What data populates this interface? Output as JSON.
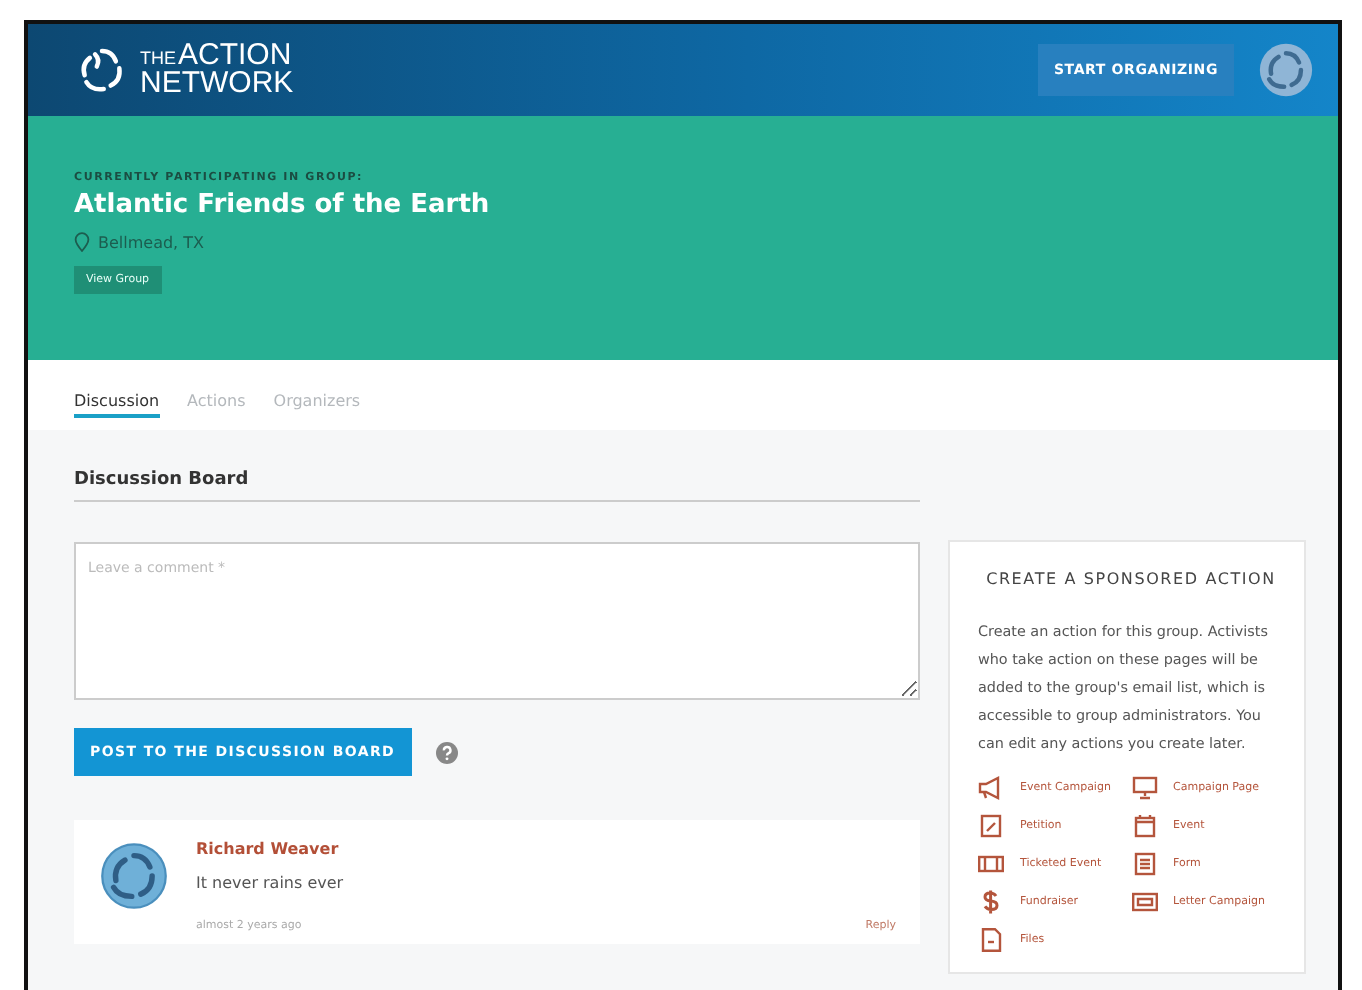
{
  "header": {
    "logo": {
      "small": "THE",
      "line1": "ACTION",
      "line2": "NETWORK"
    },
    "button": "START ORGANIZING"
  },
  "group": {
    "eyebrow": "CURRENTLY PARTICIPATING IN GROUP:",
    "name": "Atlantic Friends of the Earth",
    "location": "Bellmead, TX",
    "button": "View Group"
  },
  "tabs": [
    {
      "label": "Discussion",
      "selected": true
    },
    {
      "label": "Actions",
      "selected": false
    },
    {
      "label": "Organizers",
      "selected": false
    }
  ],
  "board": {
    "title": "Discussion Board",
    "placeholder": "Leave a comment *",
    "button": "POST TO THE DISCUSSION BOARD"
  },
  "comments": [
    {
      "author": "Richard Weaver",
      "text": "It never rains ever",
      "time": "almost 2 years ago",
      "reply": "Reply"
    }
  ],
  "sponsored": {
    "title": "CREATE A SPONSORED ACTION",
    "description": "Create an action for this group. Activists who take action on these pages will be added to the group's email list, which is accessible to group administrators. You can edit any actions you create later.",
    "actions": [
      {
        "kind": "megaphone",
        "label": "Event Campaign"
      },
      {
        "kind": "monitor",
        "label": "Campaign Page"
      },
      {
        "kind": "pencil",
        "label": "Petition"
      },
      {
        "kind": "calendar",
        "label": "Event"
      },
      {
        "kind": "ticket",
        "label": "Ticketed Event"
      },
      {
        "kind": "form",
        "label": "Form"
      },
      {
        "kind": "dollar",
        "label": "Fundraiser"
      },
      {
        "kind": "letter",
        "label": "Letter Campaign"
      },
      {
        "kind": "file",
        "label": "Files"
      }
    ]
  }
}
